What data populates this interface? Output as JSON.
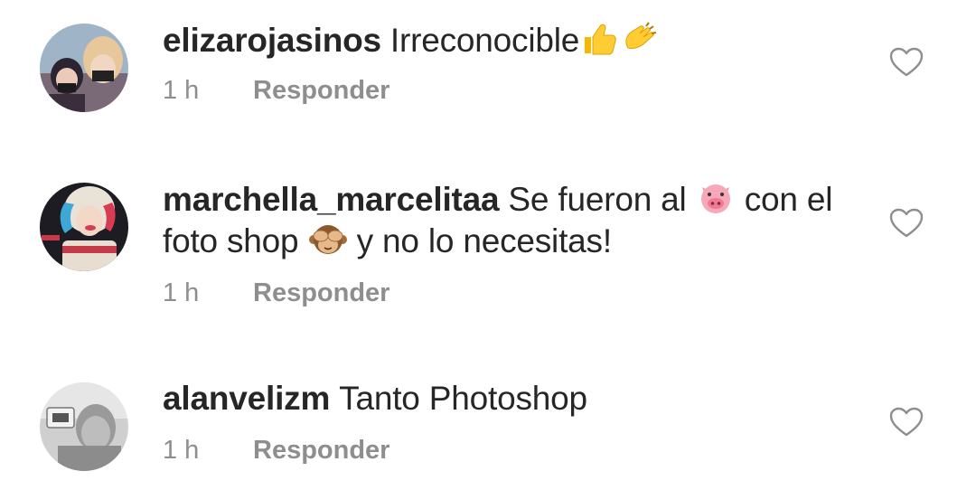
{
  "comments": [
    {
      "username": "elizarojasinos",
      "text_parts": [
        "Irreconocible"
      ],
      "emojis": [
        "thumbs-up-icon",
        "clapping-hands-icon"
      ],
      "time": "1 h",
      "reply_label": "Responder"
    },
    {
      "username": "marchella_marcelitaa",
      "text_parts": [
        "Se fueron al",
        "con el",
        "foto shop",
        "y no lo necesitas!"
      ],
      "emojis": [
        "pig-face-icon",
        "see-no-evil-monkey-icon"
      ],
      "time": "1 h",
      "reply_label": "Responder"
    },
    {
      "username": "alanvelizm",
      "text_parts": [
        "Tanto Photoshop"
      ],
      "emojis": [],
      "time": "1 h",
      "reply_label": "Responder"
    }
  ],
  "colors": {
    "text": "#262626",
    "meta": "#8e8e8e",
    "heart_outline": "#8e8e8e"
  }
}
